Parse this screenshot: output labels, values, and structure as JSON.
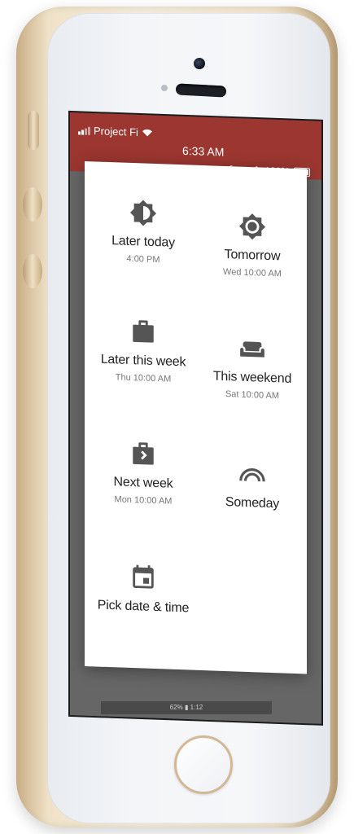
{
  "status_bar": {
    "carrier": "Project Fi",
    "time": "6:33 AM",
    "battery": "100%"
  },
  "snooze_options": [
    {
      "label": "Later today",
      "time": "4:00 PM",
      "icon": "brightness-half-icon"
    },
    {
      "label": "Tomorrow",
      "time": "Wed 10:00 AM",
      "icon": "sun-icon"
    },
    {
      "label": "Later this week",
      "time": "Thu 10:00 AM",
      "icon": "briefcase-icon"
    },
    {
      "label": "This weekend",
      "time": "Sat 10:00 AM",
      "icon": "couch-icon"
    },
    {
      "label": "Next week",
      "time": "Mon 10:00 AM",
      "icon": "briefcase-next-icon"
    },
    {
      "label": "Someday",
      "time": "",
      "icon": "rainbow-icon"
    },
    {
      "label": "Pick date & time",
      "time": "",
      "icon": "calendar-icon"
    }
  ],
  "nav_strip": "62% ▮ 1:12",
  "colors": {
    "status_bar_bg": "#9b3630",
    "icon": "#555555",
    "label": "#222222",
    "sublabel": "#777777"
  }
}
